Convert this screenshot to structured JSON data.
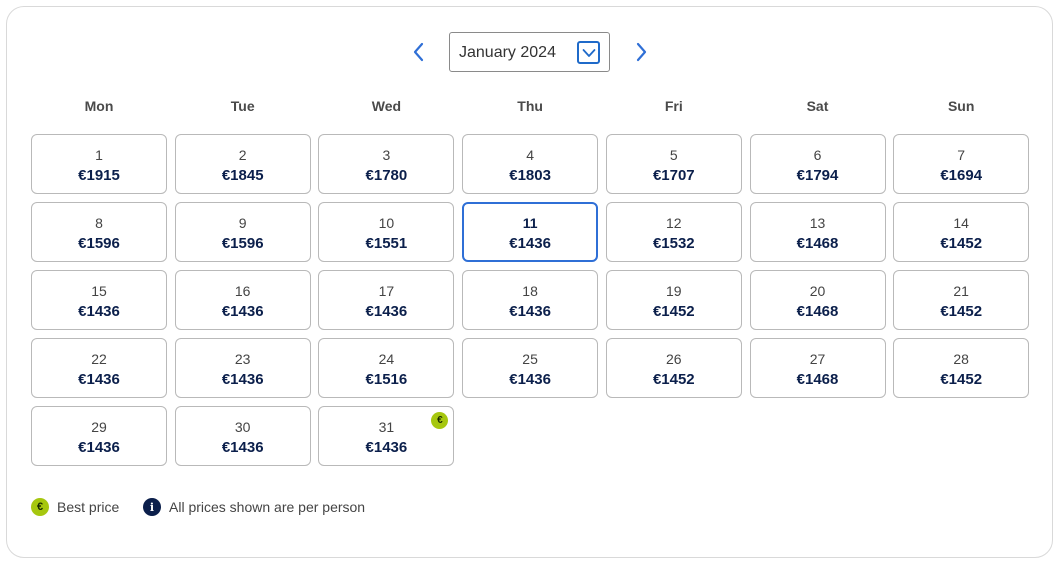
{
  "calendar": {
    "month_label": "January 2024",
    "weekdays": [
      "Mon",
      "Tue",
      "Wed",
      "Thu",
      "Fri",
      "Sat",
      "Sun"
    ],
    "days": [
      {
        "num": "1",
        "price": "€1915"
      },
      {
        "num": "2",
        "price": "€1845"
      },
      {
        "num": "3",
        "price": "€1780"
      },
      {
        "num": "4",
        "price": "€1803"
      },
      {
        "num": "5",
        "price": "€1707"
      },
      {
        "num": "6",
        "price": "€1794"
      },
      {
        "num": "7",
        "price": "€1694"
      },
      {
        "num": "8",
        "price": "€1596"
      },
      {
        "num": "9",
        "price": "€1596"
      },
      {
        "num": "10",
        "price": "€1551"
      },
      {
        "num": "11",
        "price": "€1436"
      },
      {
        "num": "12",
        "price": "€1532"
      },
      {
        "num": "13",
        "price": "€1468"
      },
      {
        "num": "14",
        "price": "€1452"
      },
      {
        "num": "15",
        "price": "€1436"
      },
      {
        "num": "16",
        "price": "€1436"
      },
      {
        "num": "17",
        "price": "€1436"
      },
      {
        "num": "18",
        "price": "€1436"
      },
      {
        "num": "19",
        "price": "€1452"
      },
      {
        "num": "20",
        "price": "€1468"
      },
      {
        "num": "21",
        "price": "€1452"
      },
      {
        "num": "22",
        "price": "€1436"
      },
      {
        "num": "23",
        "price": "€1436"
      },
      {
        "num": "24",
        "price": "€1516"
      },
      {
        "num": "25",
        "price": "€1436"
      },
      {
        "num": "26",
        "price": "€1452"
      },
      {
        "num": "27",
        "price": "€1468"
      },
      {
        "num": "28",
        "price": "€1452"
      },
      {
        "num": "29",
        "price": "€1436"
      },
      {
        "num": "30",
        "price": "€1436"
      },
      {
        "num": "31",
        "price": "€1436"
      }
    ],
    "selected_day": "11",
    "best_price_day": "31",
    "best_badge_glyph": "€"
  },
  "legend": {
    "best_glyph": "€",
    "best_label": "Best price",
    "info_glyph": "i",
    "info_label": "All prices shown are per person"
  },
  "icons": {
    "prev": "chevron-left-icon",
    "next": "chevron-right-icon",
    "dropdown": "chevron-down-icon"
  },
  "colors": {
    "accent": "#2f6fd6",
    "price_text": "#0b1f4b",
    "best_price": "#a6c70f",
    "info": "#0b1f4b"
  }
}
